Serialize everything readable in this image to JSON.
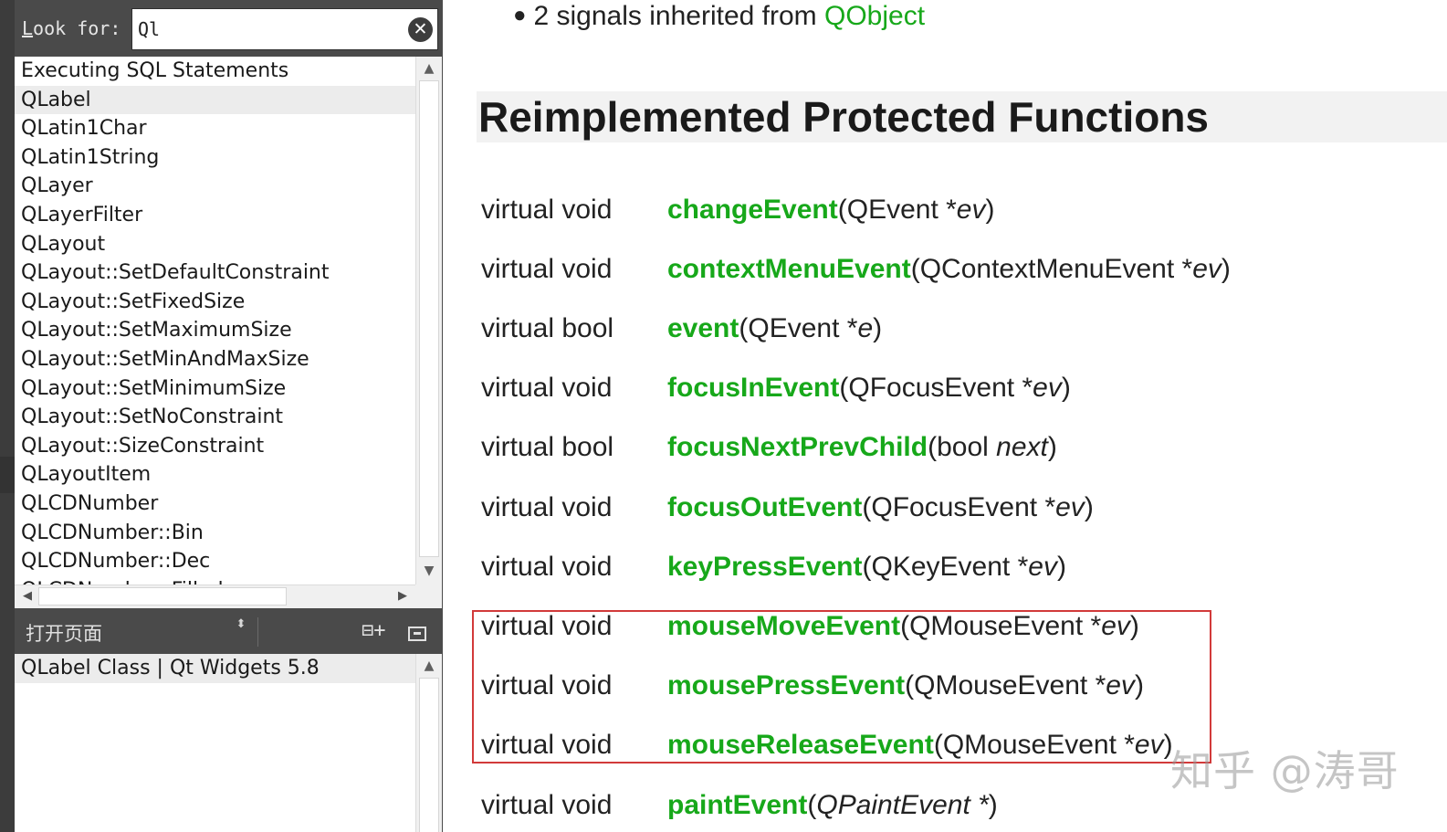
{
  "search": {
    "label_underlined": "L",
    "label_rest": "ook for:",
    "value": "Ql",
    "clear_glyph": "✕"
  },
  "index_list": {
    "items": [
      "Executing SQL Statements",
      "QLabel",
      "QLatin1Char",
      "QLatin1String",
      "QLayer",
      "QLayerFilter",
      "QLayout",
      "QLayout::SetDefaultConstraint",
      "QLayout::SetFixedSize",
      "QLayout::SetMaximumSize",
      "QLayout::SetMinAndMaxSize",
      "QLayout::SetMinimumSize",
      "QLayout::SetNoConstraint",
      "QLayout::SizeConstraint",
      "QLayoutItem",
      "QLCDNumber",
      "QLCDNumber::Bin",
      "QLCDNumber::Dec",
      "QLCDNumber::Filled"
    ],
    "selected_index": 1
  },
  "scroll": {
    "up": "▲",
    "down": "▼",
    "left": "◀",
    "right": "▶"
  },
  "open_pages": {
    "label": "打开页面",
    "combo_arrows": "⬍",
    "add_glyph": "⊟+",
    "items": [
      "QLabel Class | Qt Widgets 5.8"
    ]
  },
  "doc": {
    "signals_text": "2 signals inherited from ",
    "signals_link": "QObject",
    "section_title": "Reimplemented Protected Functions",
    "functions": [
      {
        "type": "virtual void",
        "name": "changeEvent",
        "param_type": "QEvent *",
        "param_name": "ev"
      },
      {
        "type": "virtual void",
        "name": "contextMenuEvent",
        "param_type": "QContextMenuEvent *",
        "param_name": "ev"
      },
      {
        "type": "virtual bool",
        "name": "event",
        "param_type": "QEvent *",
        "param_name": "e"
      },
      {
        "type": "virtual void",
        "name": "focusInEvent",
        "param_type": "QFocusEvent *",
        "param_name": "ev"
      },
      {
        "type": "virtual bool",
        "name": "focusNextPrevChild",
        "param_type": "bool ",
        "param_name": "next"
      },
      {
        "type": "virtual void",
        "name": "focusOutEvent",
        "param_type": "QFocusEvent *",
        "param_name": "ev"
      },
      {
        "type": "virtual void",
        "name": "keyPressEvent",
        "param_type": "QKeyEvent *",
        "param_name": "ev"
      },
      {
        "type": "virtual void",
        "name": "mouseMoveEvent",
        "param_type": "QMouseEvent *",
        "param_name": "ev"
      },
      {
        "type": "virtual void",
        "name": "mousePressEvent",
        "param_type": "QMouseEvent *",
        "param_name": "ev"
      },
      {
        "type": "virtual void",
        "name": "mouseReleaseEvent",
        "param_type": "QMouseEvent *",
        "param_name": "ev"
      },
      {
        "type": "virtual void",
        "name": "paintEvent",
        "param_type": "QPaintEvent *",
        "param_name": "",
        "italic_type": true
      }
    ],
    "highlighted_range": [
      7,
      9
    ]
  },
  "watermark": "知乎 @涛哥",
  "colors": {
    "link_green": "#17a81a",
    "highlight_red": "#d23a3a",
    "panel_dark": "#4a4a4a"
  }
}
